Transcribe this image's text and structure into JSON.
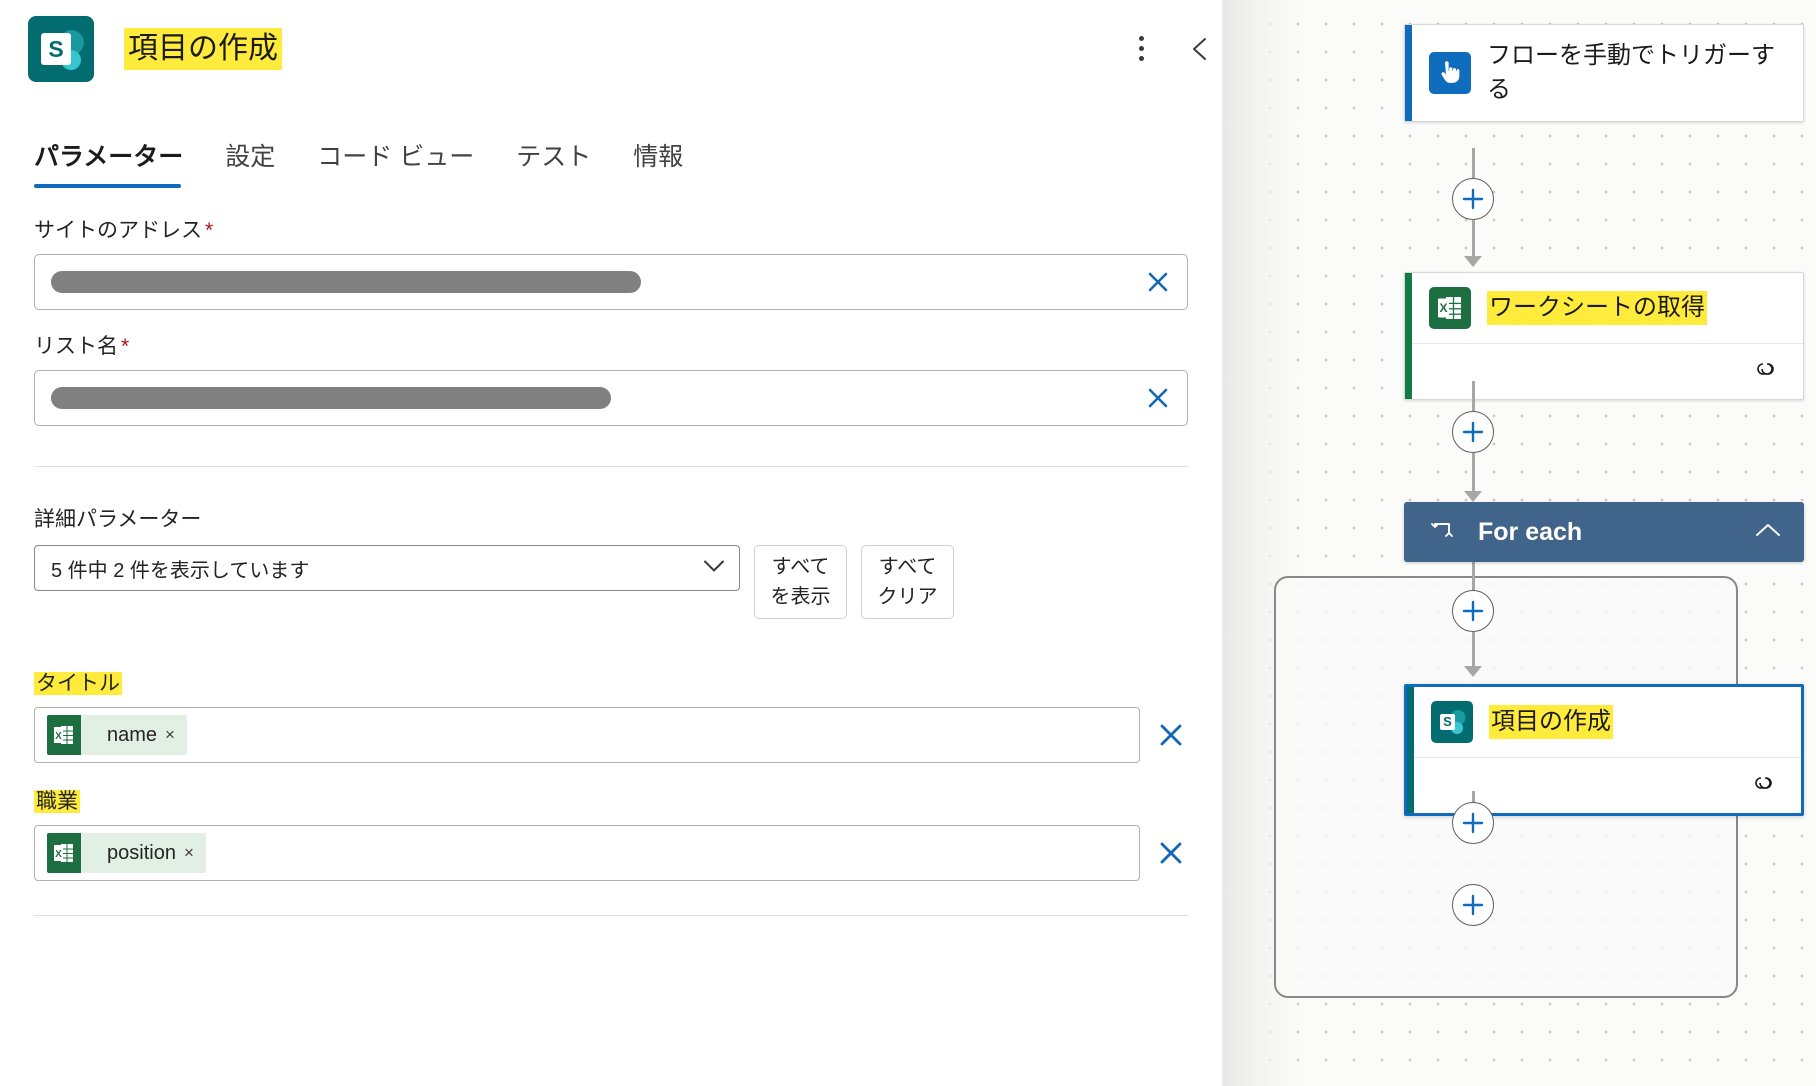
{
  "panel": {
    "icon_name": "sharepoint-icon",
    "icon_letter": "S",
    "title": "項目の作成",
    "kebab_name": "more-options-icon",
    "collapse_name": "chevron-left-icon",
    "tabs": [
      {
        "label": "パラメーター",
        "active": true
      },
      {
        "label": "設定",
        "active": false
      },
      {
        "label": "コード ビュー",
        "active": false
      },
      {
        "label": "テスト",
        "active": false
      },
      {
        "label": "情報",
        "active": false
      }
    ],
    "fields": [
      {
        "label": "サイトのアドレス",
        "required": "*",
        "value": "",
        "redacted": true
      },
      {
        "label": "リスト名",
        "required": "*",
        "value": "",
        "redacted": true
      }
    ],
    "advanced": {
      "heading": "詳細パラメーター",
      "dropdown_value": "5 件中 2 件を表示しています",
      "show_all_label": "すべてを表示",
      "clear_all_label": "すべてクリア"
    },
    "token_fields": [
      {
        "label": "タイトル",
        "chip_text": "name",
        "chip_close": "×",
        "chip_icon": "excel-icon"
      },
      {
        "label": "職業",
        "chip_text": "position",
        "chip_close": "×",
        "chip_icon": "excel-icon"
      }
    ]
  },
  "canvas": {
    "nodes": [
      {
        "id": "trigger",
        "title": "フローを手動でトリガーする",
        "icon_name": "tap-hand-icon",
        "accent": "#0f6cbd",
        "icon_bg": "#0f6cbd",
        "highlighted": false,
        "selected": false,
        "has_footer": false
      },
      {
        "id": "get-worksheet",
        "title": "ワークシートの取得",
        "icon_name": "excel-icon",
        "accent": "#107c41",
        "icon_bg": "#1d6f42",
        "highlighted": true,
        "selected": false,
        "has_footer": true,
        "footer_icon": "link-icon"
      },
      {
        "id": "create-item",
        "title": "項目の作成",
        "icon_name": "sharepoint-icon",
        "accent": "#036c70",
        "icon_bg": "#036c70",
        "highlighted": true,
        "selected": true,
        "has_footer": true,
        "footer_icon": "link-icon"
      }
    ],
    "foreach": {
      "label": "For each",
      "icon_name": "loop-icon",
      "collapse_icon_name": "chevron-up-icon",
      "header_color": "#41648a"
    },
    "add_buttons": [
      {
        "name": "add-step-after-trigger"
      },
      {
        "name": "add-step-after-worksheet"
      },
      {
        "name": "add-step-in-loop-top"
      },
      {
        "name": "add-step-in-loop-bottom"
      },
      {
        "name": "add-step-after-loop"
      }
    ],
    "plus_symbol": "+",
    "highlight_color": "#ffeb3b"
  }
}
